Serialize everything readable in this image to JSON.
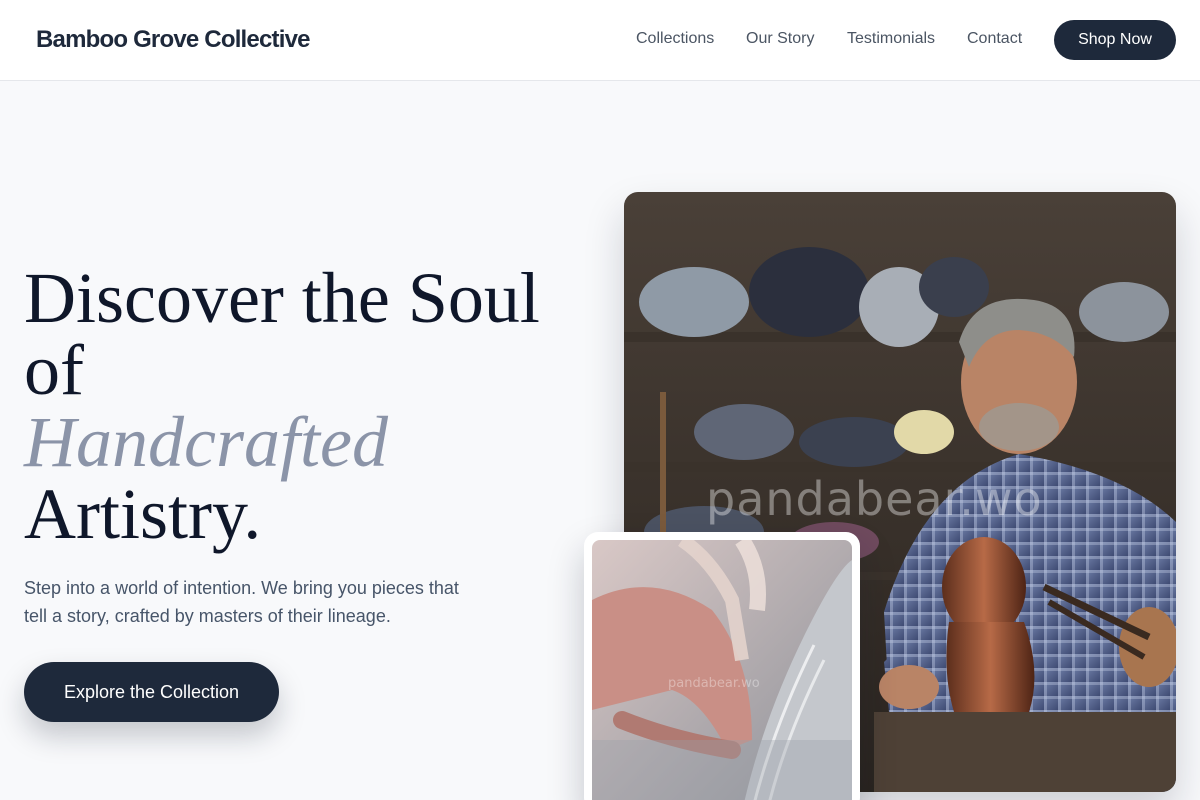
{
  "header": {
    "brand": "Bamboo Grove Collective",
    "nav": [
      {
        "label": "Collections"
      },
      {
        "label": "Our Story"
      },
      {
        "label": "Testimonials"
      },
      {
        "label": "Contact"
      }
    ],
    "cta_label": "Shop Now"
  },
  "hero": {
    "headline_line1": "Discover the Soul",
    "headline_line2": "of",
    "headline_accent": "Handcrafted",
    "headline_line4": "Artistry.",
    "subtext": "Step into a world of intention. We bring you pieces that tell a story, crafted by masters of their lineage.",
    "cta_label": "Explore the Collection"
  },
  "images": {
    "main_watermark": "pandabear.wo",
    "inset_watermark": "pandabear.wo"
  },
  "colors": {
    "primary": "#1e293b",
    "accent_text": "#8b94a8",
    "background": "#f8f9fb"
  }
}
